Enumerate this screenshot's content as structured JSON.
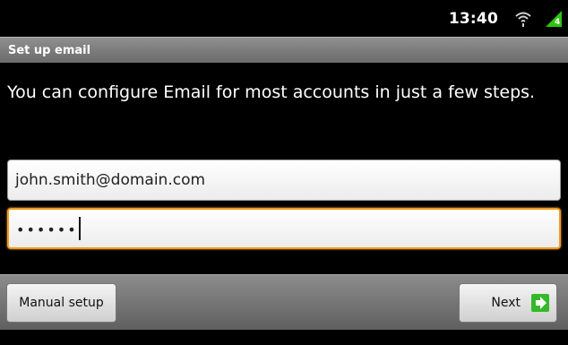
{
  "status_bar": {
    "time": "13:40",
    "icons": [
      "wifi-icon",
      "signal-icon"
    ]
  },
  "title_bar": {
    "title": "Set up email"
  },
  "main": {
    "intro": "You can configure Email for most accounts in just a few steps.",
    "email_field": {
      "value": "john.smith@domain.com"
    },
    "password_field": {
      "value": "••••••",
      "focused": true
    }
  },
  "buttons": {
    "manual_setup": "Manual setup",
    "next": "Next",
    "next_icon": "arrow-right-icon"
  },
  "colors": {
    "focus_border": "#f39a1a",
    "next_icon_green": "#35b82a",
    "signal_green": "#2fc40f"
  }
}
